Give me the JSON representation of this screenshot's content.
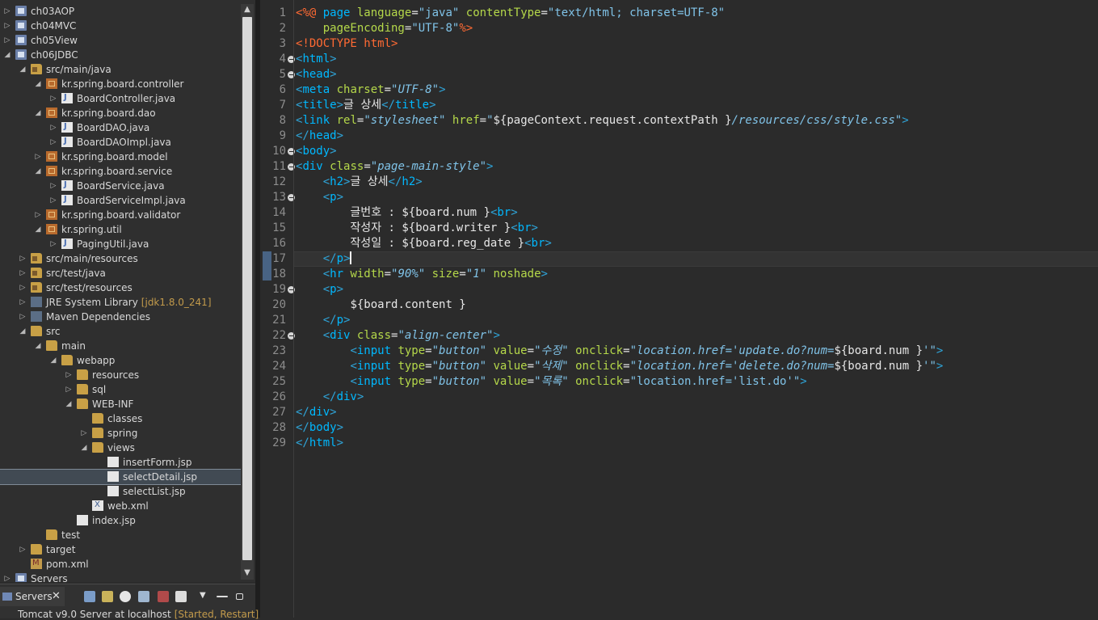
{
  "colors": {
    "editor_bg": "#2b2b2b",
    "explorer_bg": "#2f2f2f",
    "tag": "#00b8ff",
    "attribute": "#b5d84a",
    "string": "#80c3e8",
    "directive": "#ff6a33",
    "decoration": "#c29a4b",
    "selection": "#414a53"
  },
  "explorer": {
    "items": [
      {
        "label": "ch03AOP",
        "depth": 0,
        "arrow": "▷",
        "icon": "project"
      },
      {
        "label": "ch04MVC",
        "depth": 0,
        "arrow": "▷",
        "icon": "project"
      },
      {
        "label": "ch05View",
        "depth": 0,
        "arrow": "▷",
        "icon": "project"
      },
      {
        "label": "ch06JDBC",
        "depth": 0,
        "arrow": "◢",
        "icon": "project"
      },
      {
        "label": "src/main/java",
        "depth": 1,
        "arrow": "◢",
        "icon": "srcfolder"
      },
      {
        "label": "kr.spring.board.controller",
        "depth": 2,
        "arrow": "◢",
        "icon": "package"
      },
      {
        "label": "BoardController.java",
        "depth": 3,
        "arrow": "▷",
        "icon": "java"
      },
      {
        "label": "kr.spring.board.dao",
        "depth": 2,
        "arrow": "◢",
        "icon": "package"
      },
      {
        "label": "BoardDAO.java",
        "depth": 3,
        "arrow": "▷",
        "icon": "java"
      },
      {
        "label": "BoardDAOImpl.java",
        "depth": 3,
        "arrow": "▷",
        "icon": "java"
      },
      {
        "label": "kr.spring.board.model",
        "depth": 2,
        "arrow": "▷",
        "icon": "package"
      },
      {
        "label": "kr.spring.board.service",
        "depth": 2,
        "arrow": "◢",
        "icon": "package"
      },
      {
        "label": "BoardService.java",
        "depth": 3,
        "arrow": "▷",
        "icon": "java"
      },
      {
        "label": "BoardServiceImpl.java",
        "depth": 3,
        "arrow": "▷",
        "icon": "java"
      },
      {
        "label": "kr.spring.board.validator",
        "depth": 2,
        "arrow": "▷",
        "icon": "package"
      },
      {
        "label": "kr.spring.util",
        "depth": 2,
        "arrow": "◢",
        "icon": "package"
      },
      {
        "label": "PagingUtil.java",
        "depth": 3,
        "arrow": "▷",
        "icon": "java"
      },
      {
        "label": "src/main/resources",
        "depth": 1,
        "arrow": "▷",
        "icon": "srcfolder"
      },
      {
        "label": "src/test/java",
        "depth": 1,
        "arrow": "▷",
        "icon": "srcfolder"
      },
      {
        "label": "src/test/resources",
        "depth": 1,
        "arrow": "▷",
        "icon": "srcfolder"
      },
      {
        "label": "JRE System Library",
        "decoration": "[jdk1.8.0_241]",
        "depth": 1,
        "arrow": "▷",
        "icon": "lib"
      },
      {
        "label": "Maven Dependencies",
        "depth": 1,
        "arrow": "▷",
        "icon": "lib"
      },
      {
        "label": "src",
        "depth": 1,
        "arrow": "◢",
        "icon": "folder"
      },
      {
        "label": "main",
        "depth": 2,
        "arrow": "◢",
        "icon": "folder"
      },
      {
        "label": "webapp",
        "depth": 3,
        "arrow": "◢",
        "icon": "folder"
      },
      {
        "label": "resources",
        "depth": 4,
        "arrow": "▷",
        "icon": "folder"
      },
      {
        "label": "sql",
        "depth": 4,
        "arrow": "▷",
        "icon": "folder"
      },
      {
        "label": "WEB-INF",
        "depth": 4,
        "arrow": "◢",
        "icon": "folder"
      },
      {
        "label": "classes",
        "depth": 5,
        "arrow": "",
        "icon": "folder"
      },
      {
        "label": "spring",
        "depth": 5,
        "arrow": "▷",
        "icon": "folder"
      },
      {
        "label": "views",
        "depth": 5,
        "arrow": "◢",
        "icon": "folder"
      },
      {
        "label": "insertForm.jsp",
        "depth": 6,
        "arrow": "",
        "icon": "jsp"
      },
      {
        "label": "selectDetail.jsp",
        "depth": 6,
        "arrow": "",
        "icon": "jsp",
        "selected": true
      },
      {
        "label": "selectList.jsp",
        "depth": 6,
        "arrow": "",
        "icon": "jsp"
      },
      {
        "label": "web.xml",
        "depth": 5,
        "arrow": "",
        "icon": "xml"
      },
      {
        "label": "index.jsp",
        "depth": 4,
        "arrow": "",
        "icon": "jsp"
      },
      {
        "label": "test",
        "depth": 2,
        "arrow": "",
        "icon": "folder"
      },
      {
        "label": "target",
        "depth": 1,
        "arrow": "▷",
        "icon": "folder"
      },
      {
        "label": "pom.xml",
        "depth": 1,
        "arrow": "",
        "icon": "maven"
      },
      {
        "label": "Servers",
        "depth": 0,
        "arrow": "▷",
        "icon": "project"
      }
    ]
  },
  "servers": {
    "tab_label": "Servers",
    "close_glyph": "✕",
    "entry_label": "Tomcat v9.0 Server at localhost",
    "entry_state": "[Started, Restart]"
  },
  "editor": {
    "line_numbers": [
      "1",
      "2",
      "3",
      "4",
      "5",
      "6",
      "7",
      "8",
      "9",
      "10",
      "11",
      "12",
      "13",
      "14",
      "15",
      "16",
      "17",
      "18",
      "19",
      "20",
      "21",
      "22",
      "23",
      "24",
      "25",
      "26",
      "27",
      "28",
      "29"
    ],
    "fold_lines": [
      4,
      5,
      10,
      11,
      13,
      19,
      22
    ],
    "current_line": 17,
    "lines": [
      [
        [
          "dir",
          "<%@ "
        ],
        [
          "tag",
          "page "
        ],
        [
          "attr",
          "language"
        ],
        [
          "eq",
          "="
        ],
        [
          "str",
          "\"java\" "
        ],
        [
          "attr",
          "contentType"
        ],
        [
          "eq",
          "="
        ],
        [
          "str",
          "\"text/html; charset=UTF-8\""
        ]
      ],
      [
        [
          "text",
          "    "
        ],
        [
          "attr",
          "pageEncoding"
        ],
        [
          "eq",
          "="
        ],
        [
          "str",
          "\"UTF-8\""
        ],
        [
          "dir",
          "%>"
        ]
      ],
      [
        [
          "dtag",
          "<!DOCTYPE "
        ],
        [
          "dtag",
          "html"
        ],
        [
          "dtag",
          ">"
        ]
      ],
      [
        [
          "angle",
          "<"
        ],
        [
          "tag",
          "html"
        ],
        [
          "angle",
          ">"
        ]
      ],
      [
        [
          "angle",
          "<"
        ],
        [
          "tag",
          "head"
        ],
        [
          "angle",
          ">"
        ]
      ],
      [
        [
          "angle",
          "<"
        ],
        [
          "tag",
          "meta "
        ],
        [
          "attr",
          "charset"
        ],
        [
          "eq",
          "="
        ],
        [
          "istr",
          "\"UTF-8\""
        ],
        [
          "angle",
          ">"
        ]
      ],
      [
        [
          "angle",
          "<"
        ],
        [
          "tag",
          "title"
        ],
        [
          "angle",
          ">"
        ],
        [
          "text",
          "글 상세"
        ],
        [
          "angle",
          "</"
        ],
        [
          "tag",
          "title"
        ],
        [
          "angle",
          ">"
        ]
      ],
      [
        [
          "angle",
          "<"
        ],
        [
          "tag",
          "link "
        ],
        [
          "attr",
          "rel"
        ],
        [
          "eq",
          "="
        ],
        [
          "istr",
          "\"stylesheet\" "
        ],
        [
          "attr",
          "href"
        ],
        [
          "eq",
          "="
        ],
        [
          "str",
          "\""
        ],
        [
          "el",
          "${pageContext.request.contextPath }"
        ],
        [
          "istr",
          "/resources/css/style.css\""
        ],
        [
          "angle",
          ">"
        ]
      ],
      [
        [
          "angle",
          "</"
        ],
        [
          "tag",
          "head"
        ],
        [
          "angle",
          ">"
        ]
      ],
      [
        [
          "angle",
          "<"
        ],
        [
          "tag",
          "body"
        ],
        [
          "angle",
          ">"
        ]
      ],
      [
        [
          "angle",
          "<"
        ],
        [
          "tag",
          "div "
        ],
        [
          "attr",
          "class"
        ],
        [
          "eq",
          "="
        ],
        [
          "istr",
          "\"page-main-style\""
        ],
        [
          "angle",
          ">"
        ]
      ],
      [
        [
          "text",
          "    "
        ],
        [
          "angle",
          "<"
        ],
        [
          "tag",
          "h2"
        ],
        [
          "angle",
          ">"
        ],
        [
          "text",
          "글 상세"
        ],
        [
          "angle",
          "</"
        ],
        [
          "tag",
          "h2"
        ],
        [
          "angle",
          ">"
        ]
      ],
      [
        [
          "text",
          "    "
        ],
        [
          "angle",
          "<"
        ],
        [
          "tag",
          "p"
        ],
        [
          "angle",
          ">"
        ]
      ],
      [
        [
          "text",
          "        글번호 : "
        ],
        [
          "el",
          "${board.num }"
        ],
        [
          "angle",
          "<"
        ],
        [
          "tag",
          "br"
        ],
        [
          "angle",
          ">"
        ]
      ],
      [
        [
          "text",
          "        작성자 : "
        ],
        [
          "el",
          "${board.writer }"
        ],
        [
          "angle",
          "<"
        ],
        [
          "tag",
          "br"
        ],
        [
          "angle",
          ">"
        ]
      ],
      [
        [
          "text",
          "        작성일 : "
        ],
        [
          "el",
          "${board.reg_date }"
        ],
        [
          "angle",
          "<"
        ],
        [
          "tag",
          "br"
        ],
        [
          "angle",
          ">"
        ]
      ],
      [
        [
          "text",
          "    "
        ],
        [
          "angle",
          "</"
        ],
        [
          "tag",
          "p"
        ],
        [
          "angle",
          ">"
        ],
        [
          "cursor",
          ""
        ]
      ],
      [
        [
          "text",
          "    "
        ],
        [
          "angle",
          "<"
        ],
        [
          "tag",
          "hr "
        ],
        [
          "attr",
          "width"
        ],
        [
          "eq",
          "="
        ],
        [
          "istr",
          "\"90%\" "
        ],
        [
          "attr",
          "size"
        ],
        [
          "eq",
          "="
        ],
        [
          "istr",
          "\"1\" "
        ],
        [
          "attr",
          "noshade"
        ],
        [
          "angle",
          ">"
        ]
      ],
      [
        [
          "text",
          "    "
        ],
        [
          "angle",
          "<"
        ],
        [
          "tag",
          "p"
        ],
        [
          "angle",
          ">"
        ]
      ],
      [
        [
          "text",
          "        "
        ],
        [
          "el",
          "${board.content }"
        ]
      ],
      [
        [
          "text",
          "    "
        ],
        [
          "angle",
          "</"
        ],
        [
          "tag",
          "p"
        ],
        [
          "angle",
          ">"
        ]
      ],
      [
        [
          "text",
          "    "
        ],
        [
          "angle",
          "<"
        ],
        [
          "tag",
          "div "
        ],
        [
          "attr",
          "class"
        ],
        [
          "eq",
          "="
        ],
        [
          "istr",
          "\"align-center\""
        ],
        [
          "angle",
          ">"
        ]
      ],
      [
        [
          "text",
          "        "
        ],
        [
          "angle",
          "<"
        ],
        [
          "tag",
          "input "
        ],
        [
          "attr",
          "type"
        ],
        [
          "eq",
          "="
        ],
        [
          "istr",
          "\"button\" "
        ],
        [
          "attr",
          "value"
        ],
        [
          "eq",
          "="
        ],
        [
          "istr",
          "\"수정\" "
        ],
        [
          "attr",
          "onclick"
        ],
        [
          "eq",
          "="
        ],
        [
          "istr",
          "\"location.href='update.do?num="
        ],
        [
          "el",
          "${board.num }"
        ],
        [
          "istr",
          "'\""
        ],
        [
          "angle",
          ">"
        ]
      ],
      [
        [
          "text",
          "        "
        ],
        [
          "angle",
          "<"
        ],
        [
          "tag",
          "input "
        ],
        [
          "attr",
          "type"
        ],
        [
          "eq",
          "="
        ],
        [
          "istr",
          "\"button\" "
        ],
        [
          "attr",
          "value"
        ],
        [
          "eq",
          "="
        ],
        [
          "istr",
          "\"삭제\" "
        ],
        [
          "attr",
          "onclick"
        ],
        [
          "eq",
          "="
        ],
        [
          "istr",
          "\"location.href='delete.do?num="
        ],
        [
          "el",
          "${board.num }"
        ],
        [
          "istr",
          "'\""
        ],
        [
          "angle",
          ">"
        ]
      ],
      [
        [
          "text",
          "        "
        ],
        [
          "angle",
          "<"
        ],
        [
          "tag",
          "input "
        ],
        [
          "attr",
          "type"
        ],
        [
          "eq",
          "="
        ],
        [
          "istr",
          "\"button\" "
        ],
        [
          "attr",
          "value"
        ],
        [
          "eq",
          "="
        ],
        [
          "istr",
          "\"목록\" "
        ],
        [
          "attr",
          "onclick"
        ],
        [
          "eq",
          "="
        ],
        [
          "str",
          "\"location.href='list.do'\""
        ],
        [
          "angle",
          ">"
        ]
      ],
      [
        [
          "text",
          "    "
        ],
        [
          "angle",
          "</"
        ],
        [
          "tag",
          "div"
        ],
        [
          "angle",
          ">"
        ]
      ],
      [
        [
          "angle",
          "</"
        ],
        [
          "tag",
          "div"
        ],
        [
          "angle",
          ">"
        ]
      ],
      [
        [
          "angle",
          "</"
        ],
        [
          "tag",
          "body"
        ],
        [
          "angle",
          ">"
        ]
      ],
      [
        [
          "angle",
          "</"
        ],
        [
          "tag",
          "html"
        ],
        [
          "angle",
          ">"
        ]
      ]
    ]
  }
}
